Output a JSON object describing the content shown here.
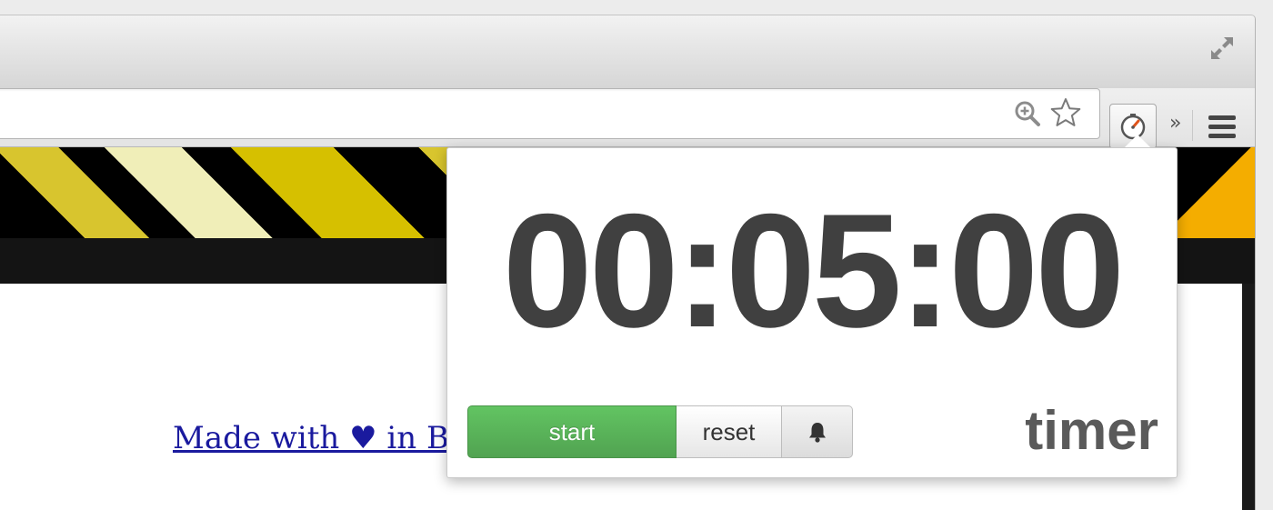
{
  "browser": {
    "omnibox": {
      "value": "",
      "placeholder": ""
    },
    "overflow_label": "»",
    "icons": {
      "fullscreen": "fullscreen-expand-icon",
      "zoom": "zoom-in-icon",
      "bookmark": "bookmark-star-icon",
      "extension": "timer-extension-icon",
      "menu": "hamburger-menu-icon"
    }
  },
  "page": {
    "footer_link_text": "Made with ♥ in Ba"
  },
  "popup": {
    "time": "00:05:00",
    "buttons": {
      "start": "start",
      "reset": "reset",
      "bell": "bell-icon"
    },
    "brand": "timer"
  },
  "colors": {
    "start_green": "#5bb75b",
    "timer_text": "#404040",
    "link_blue": "#1a1a9e",
    "stripe_yellow": "#d6c000",
    "stripe_cream": "#f0eeb8",
    "banner_orange": "#f4ad00"
  }
}
